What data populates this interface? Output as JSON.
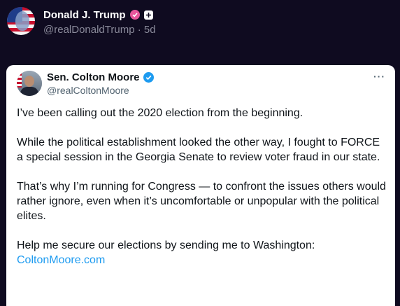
{
  "post": {
    "author_name": "Donald J. Trump",
    "handle": "@realDonaldTrump",
    "separator": "·",
    "time": "5d"
  },
  "quote": {
    "author_name": "Sen. Colton Moore",
    "handle": "@realColtonMoore",
    "more_icon": "···",
    "paragraphs": [
      "I’ve been calling out the 2020 election from the beginning.",
      "While the political establishment looked the other way, I fought to FORCE a special session in the Georgia Senate to review voter fraud in our state.",
      "That’s why I’m running for Congress — to confront the issues others would rather ignore, even when it’s uncomfortable or unpopular with the political elites.",
      "Help me secure our elections by sending me to Washington:"
    ],
    "link": "ColtonMoore.com"
  },
  "colors": {
    "background": "#0f0b20",
    "pink_badge": "#e8559b",
    "verified_blue": "#1d9bf0"
  }
}
